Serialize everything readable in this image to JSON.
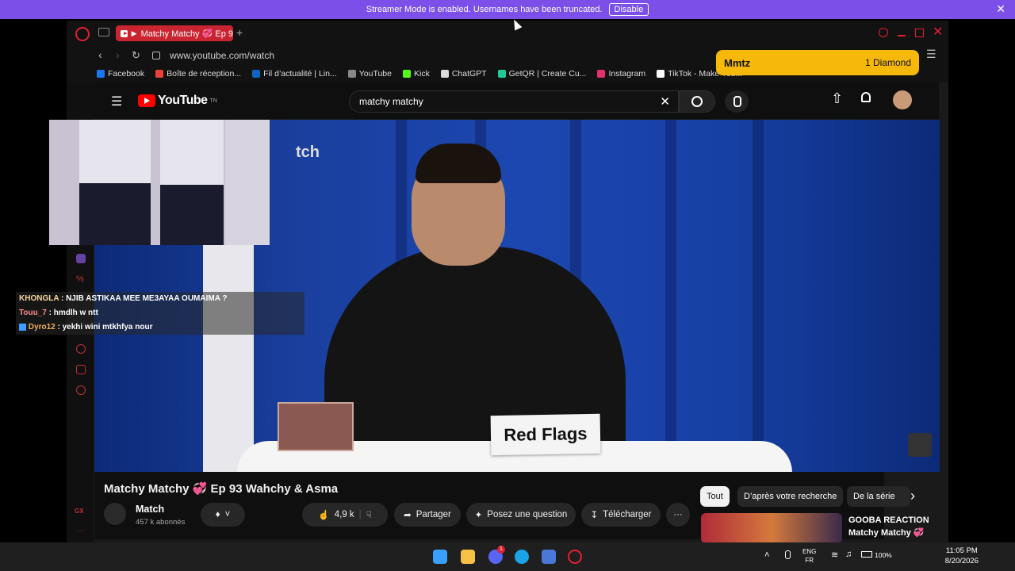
{
  "banner": {
    "text": "Streamer Mode is enabled. Usernames have been truncated.",
    "disable_label": "Disable",
    "close_glyph": "✕"
  },
  "browser": {
    "tab_label": "Matchy Matchy 💞 Ep 9",
    "new_tab_glyph": "+",
    "url": "www.youtube.com/watch",
    "bookmarks": [
      {
        "label": "Facebook",
        "color": "#1877f2"
      },
      {
        "label": "Boîte de réception...",
        "color": "#ea4335"
      },
      {
        "label": "Fil d’actualité | Lin...",
        "color": "#0a66c2"
      },
      {
        "label": "YouTube",
        "color": "#888888"
      },
      {
        "label": "Kick",
        "color": "#53fc18"
      },
      {
        "label": "ChatGPT",
        "color": "#dddddd"
      },
      {
        "label": "GetQR | Create Cu...",
        "color": "#20c997"
      },
      {
        "label": "Instagram",
        "color": "#e1306c"
      },
      {
        "label": "TikTok - Make You...",
        "color": "#ffffff"
      }
    ]
  },
  "youtube": {
    "logo_text": "YouTube",
    "logo_sup": "TN",
    "search_value": "matchy matchy",
    "video_title": "Matchy Matchy 💞 Ep 93 Wahchy & Asma",
    "channel_name": "Match",
    "subscribers": "457 k abonnés",
    "likes": "4,9 k",
    "share_label": "Partager",
    "ask_label": "Posez une question",
    "download_label": "Télécharger",
    "more_glyph": "···",
    "chips": [
      "Tout",
      "D’après votre recherche",
      "De la série"
    ],
    "chip_next_glyph": "›",
    "rec_title_1": "GOOBA REACTION",
    "rec_title_2": "Matchy Matchy 💞",
    "video_sign": "Red Flags",
    "video_watermark": "tch"
  },
  "chat": [
    {
      "user": "KHONGLA",
      "message": "NJIB ASTIKAA MEE ME3AYAA OUMAIMA ?",
      "color": "#f5d7a0"
    },
    {
      "user": "Touu_7",
      "message": "hmdlh w ntt",
      "color": "#ff8a8a"
    },
    {
      "user": "Dyro12",
      "message": "yekhi wini mtkhfya nour",
      "color": "#f0b060"
    }
  ],
  "notification": {
    "name": "Mmtz",
    "amount": "1",
    "label": "Diamond"
  },
  "taskbar": {
    "lang_top": "ENG",
    "lang_bottom": "FR",
    "battery": "100%",
    "time": "11:05 PM",
    "date": "8/20/2026",
    "discord_badge": "1"
  }
}
